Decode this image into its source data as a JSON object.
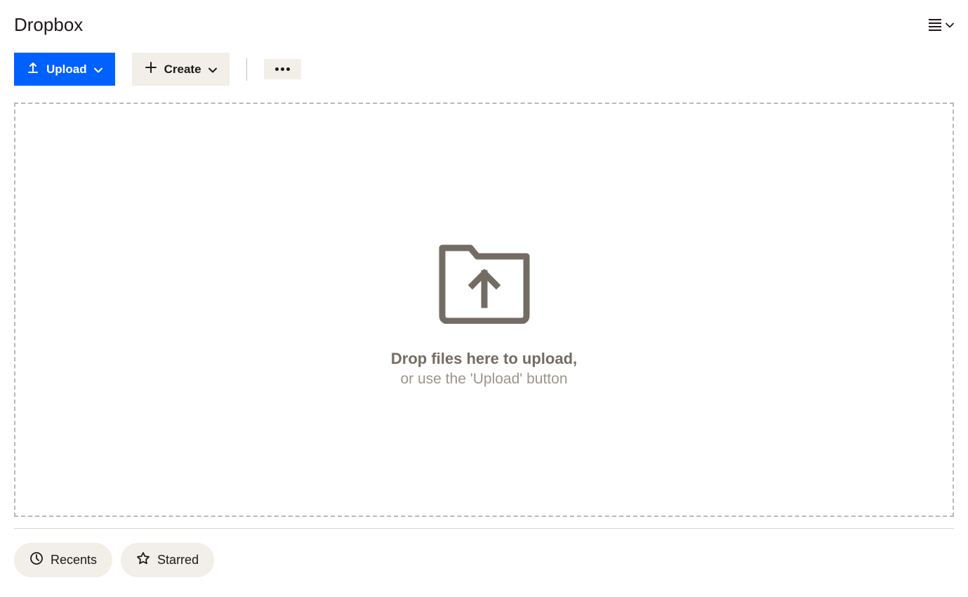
{
  "header": {
    "title": "Dropbox"
  },
  "toolbar": {
    "upload_label": "Upload",
    "create_label": "Create"
  },
  "dropzone": {
    "primary_text": "Drop files here to upload,",
    "secondary_text": "or use the 'Upload' button"
  },
  "chips": {
    "recents_label": "Recents",
    "starred_label": "Starred"
  }
}
